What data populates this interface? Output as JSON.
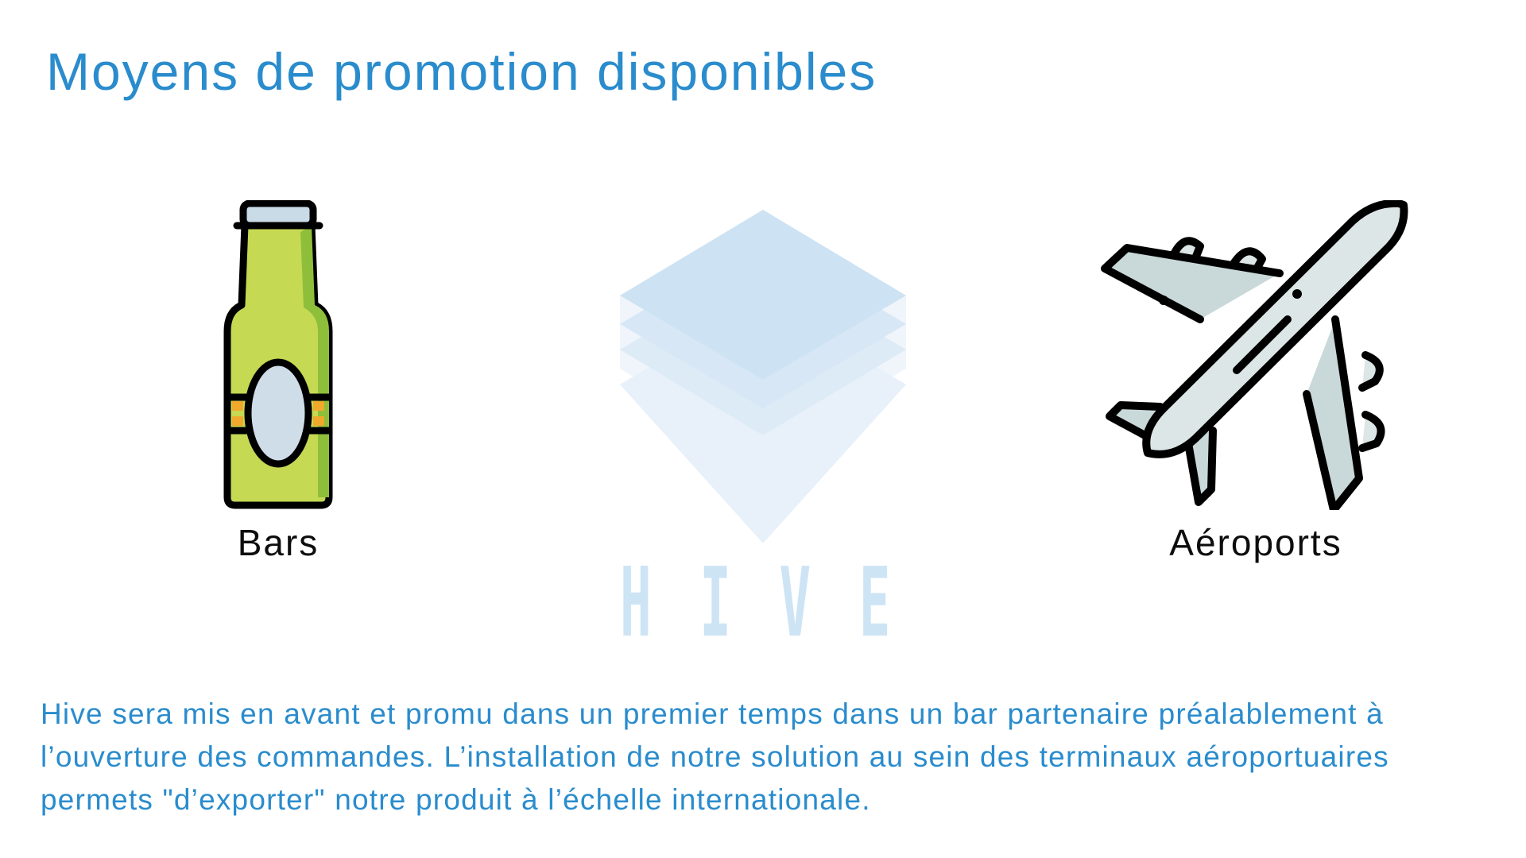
{
  "title": "Moyens de promotion disponibles",
  "items": [
    {
      "label": "Bars",
      "icon": "beer-bottle-icon"
    },
    {
      "label": "Aéroports",
      "icon": "airplane-icon"
    }
  ],
  "logo": {
    "text": "HIVE",
    "icon": "hive-layers-logo"
  },
  "description": "Hive sera mis en avant et promu dans un premier temps dans un bar partenaire préalablement à l’ouverture des commandes. L’installation de notre solution au sein des terminaux aéroportuaires permets \"d’exporter\" notre produit à l’échelle internationale.",
  "colors": {
    "accent": "#2a8ccd",
    "logo": "#cde4f5",
    "bottle": "#c5d952",
    "plane": "#dde6e6"
  }
}
